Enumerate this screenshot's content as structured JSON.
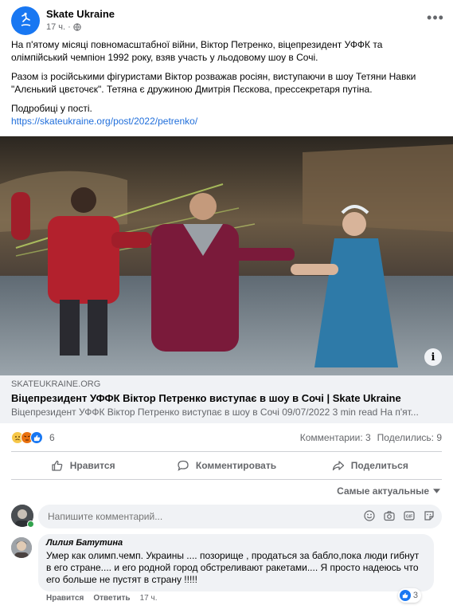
{
  "post": {
    "author": "Skate Ukraine",
    "time": "17 ч.",
    "privacy_icon": "globe-icon",
    "paragraphs": [
      "На п'ятому місяці повномасштабної війни, Віктор Петренко, віцепрезидент УФФК та олімпійський чемпіон 1992 року, взяв участь у льодовому шоу в Сочі.",
      "Разом із російськими фігуристами Віктор розважав росіян, виступаючи в шоу Тетяни Навки \"Алєнький цвєточєк\". Тетяна є дружиною Дмитрія Пєскова, прессекретаря путіна.",
      "Подробиці у пості."
    ],
    "link_text": "https://skateukraine.org/post/2022/petrenko/"
  },
  "link_card": {
    "domain": "SKATEUKRAINE.ORG",
    "title": "Віцепрезидент УФФК Віктор Петренко виступає в шоу в Сочі | Skate Ukraine",
    "description": "Віцепрезидент УФФК Віктор Петренко виступає в шоу в Сочі 09/07/2022 3 min read На п'ят..."
  },
  "reactions": {
    "count": "6",
    "comments": "Комментарии: 3",
    "shares": "Поделились: 9"
  },
  "actions": {
    "like": "Нравится",
    "comment": "Комментировать",
    "share": "Поделиться"
  },
  "sort_label": "Самые актуальные",
  "composer": {
    "placeholder": "Напишите комментарий..."
  },
  "comment": {
    "author": "Лилия Батутина",
    "text": "Умер как олимп.чемп. Украины .... позорище , продаться за бабло,пока люди гибнут в его стране.... и его родной город обстреливают ракетами.... Я просто надеюсь что его больше не пустят в страну !!!!!",
    "like_label": "Нравится",
    "reply_label": "Ответить",
    "time": "17 ч.",
    "reaction_count": "3"
  },
  "colors": {
    "brand": "#1877f2",
    "link": "#216fdb",
    "muted": "#65676b",
    "surface": "#f0f2f5"
  }
}
